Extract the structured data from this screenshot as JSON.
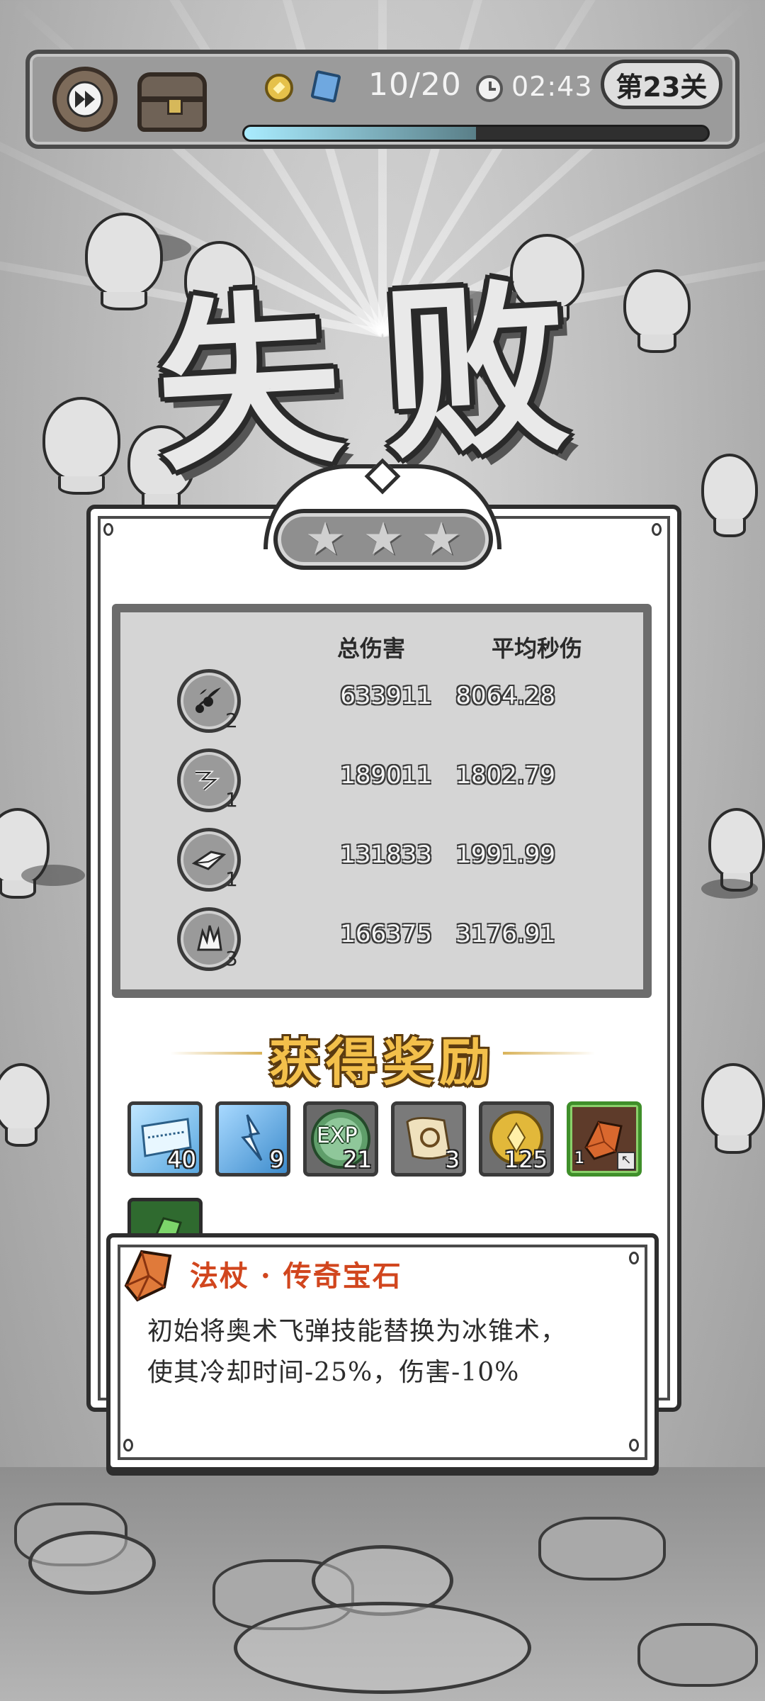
{
  "hud": {
    "wave_progress": "10/20",
    "timer": "02:43",
    "level": "第23关",
    "wave_fraction": 0.5
  },
  "result": {
    "title": "失败",
    "stars_earned": 0,
    "stars_total": 3
  },
  "stats": {
    "headers": {
      "total_damage": "总伤害",
      "dps": "平均秒伤"
    },
    "rows": [
      {
        "icon": "dark-missiles-icon",
        "level": "2",
        "total_damage": "633911",
        "dps": "8064.28"
      },
      {
        "icon": "lightning-chain-icon",
        "level": "1",
        "total_damage": "189011",
        "dps": "1802.79"
      },
      {
        "icon": "ice-shard-icon",
        "level": "1",
        "total_damage": "131833",
        "dps": "1991.99"
      },
      {
        "icon": "crystal-burst-icon",
        "level": "3",
        "total_damage": "166375",
        "dps": "3176.91"
      }
    ]
  },
  "rewards": {
    "title": "获得奖励",
    "items": [
      {
        "icon": "frost-card-icon",
        "count": "40",
        "color": "#7fc3ee"
      },
      {
        "icon": "ice-bolt-card-icon",
        "count": "9",
        "color": "#6fb3e6"
      },
      {
        "icon": "exp-orb-icon",
        "count": "21",
        "label": "EXP",
        "color": "#5f9e6a"
      },
      {
        "icon": "scroll-icon",
        "count": "3",
        "color": "#d8c8a4"
      },
      {
        "icon": "gold-coin-icon",
        "count": "125",
        "color": "#e2b83a"
      },
      {
        "icon": "legendary-gem-icon",
        "count": "1",
        "color": "#5e3b2a"
      },
      {
        "icon": "green-gem-icon",
        "count": "",
        "color": "#3d7a3a"
      }
    ]
  },
  "tooltip": {
    "title": "法杖 · 传奇宝石",
    "line1": "初始将奥术飞弹技能替换为冰锥术，",
    "line2": "使其冷却时间-25%，伤害-10%"
  }
}
